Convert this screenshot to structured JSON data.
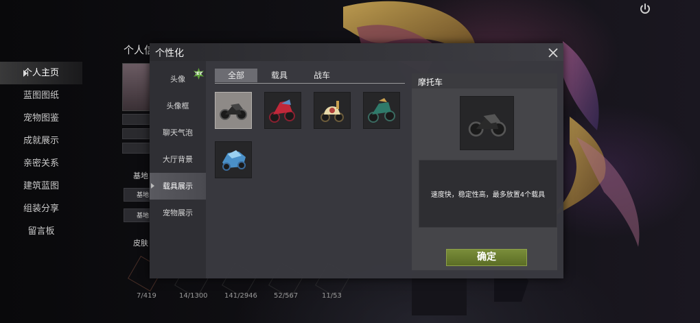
{
  "background": {
    "profile_title": "个人信",
    "left_menu": [
      {
        "label": "个人主页",
        "active": true
      },
      {
        "label": "蓝图图纸",
        "active": false
      },
      {
        "label": "宠物图鉴",
        "active": false
      },
      {
        "label": "成就展示",
        "active": false
      },
      {
        "label": "亲密关系",
        "active": false
      },
      {
        "label": "建筑蓝图",
        "active": false
      },
      {
        "label": "组装分享",
        "active": false
      },
      {
        "label": "留言板",
        "active": false
      }
    ],
    "base_label": "基地",
    "base_row_1": "基地",
    "base_row_2": "基地",
    "skin_label": "皮肤",
    "stats": [
      "7/419",
      "14/1300",
      "141/2946",
      "52/567",
      "11/53"
    ]
  },
  "modal": {
    "title": "个性化",
    "side_tabs": [
      {
        "label": "头像",
        "new": true,
        "active": false
      },
      {
        "label": "头像框",
        "new": false,
        "active": false
      },
      {
        "label": "聊天气泡",
        "new": false,
        "active": false
      },
      {
        "label": "大厅背景",
        "new": false,
        "active": false
      },
      {
        "label": "载具展示",
        "new": false,
        "active": true
      },
      {
        "label": "宠物展示",
        "new": false,
        "active": false
      }
    ],
    "new_badge": "NEW",
    "category_tabs": [
      {
        "label": "全部",
        "active": true
      },
      {
        "label": "载具",
        "active": false
      },
      {
        "label": "战车",
        "active": false
      }
    ],
    "items": [
      {
        "name": "motorcycle-black",
        "selected": true
      },
      {
        "name": "motorcycle-red",
        "selected": false
      },
      {
        "name": "scooter-cream",
        "selected": false
      },
      {
        "name": "motorcycle-teal",
        "selected": false
      },
      {
        "name": "vehicle-blue",
        "selected": false
      }
    ],
    "detail": {
      "title": "摩托车",
      "description": "速度快，稳定性高，最多放置4个载具",
      "confirm_label": "确定"
    }
  },
  "colors": {
    "accent_green": "#6b7f2f",
    "new_badge_green": "#5fa33a"
  }
}
